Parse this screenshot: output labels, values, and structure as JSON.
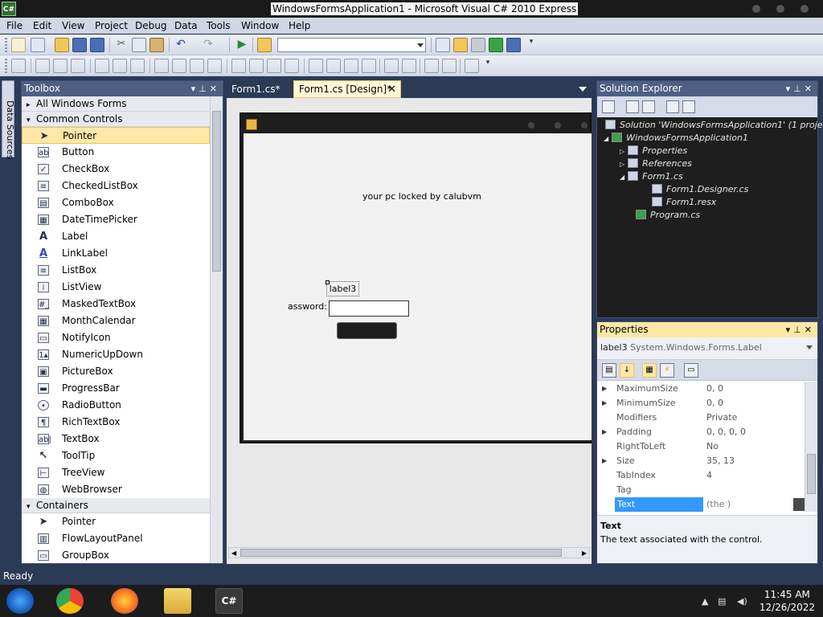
{
  "window": {
    "title": "WindowsFormsApplication1 - Microsoft Visual C# 2010 Express",
    "icon": "csharp-icon"
  },
  "menu": [
    "File",
    "Edit",
    "View",
    "Project",
    "Debug",
    "Data",
    "Tools",
    "Window",
    "Help"
  ],
  "toolbar": {
    "combo_value": ""
  },
  "data_sources_label": "Data Sources",
  "toolbox": {
    "title": "Toolbox",
    "categories": [
      {
        "label": "All Windows Forms",
        "expanded": false
      },
      {
        "label": "Common Controls",
        "expanded": true
      },
      {
        "label": "Containers",
        "expanded": true
      }
    ],
    "common_items": [
      "Pointer",
      "Button",
      "CheckBox",
      "CheckedListBox",
      "ComboBox",
      "DateTimePicker",
      "Label",
      "LinkLabel",
      "ListBox",
      "ListView",
      "MaskedTextBox",
      "MonthCalendar",
      "NotifyIcon",
      "NumericUpDown",
      "PictureBox",
      "ProgressBar",
      "RadioButton",
      "RichTextBox",
      "TextBox",
      "ToolTip",
      "TreeView",
      "WebBrowser"
    ],
    "container_items": [
      "Pointer",
      "FlowLayoutPanel",
      "GroupBox"
    ],
    "selected": "Pointer"
  },
  "tabs": [
    {
      "label": "Form1.cs*",
      "active": false
    },
    {
      "label": "Form1.cs [Design]*",
      "active": true
    }
  ],
  "form": {
    "lock_message": "your pc locked by calubvm",
    "label3_text": "label3",
    "password_label": "assword:",
    "password_value": ""
  },
  "solution_explorer": {
    "title": "Solution Explorer",
    "nodes": [
      "Solution 'WindowsFormsApplication1' (1 project)",
      "WindowsFormsApplication1",
      "Properties",
      "References",
      "Form1.cs",
      "Form1.Designer.cs",
      "Form1.resx",
      "Program.cs"
    ]
  },
  "properties": {
    "title": "Properties",
    "object_name": "label3",
    "object_type": "System.Windows.Forms.Label",
    "rows": [
      {
        "name": "MaximumSize",
        "value": "0, 0",
        "expandable": true
      },
      {
        "name": "MinimumSize",
        "value": "0, 0",
        "expandable": true
      },
      {
        "name": "Modifiers",
        "value": "Private",
        "expandable": false
      },
      {
        "name": "Padding",
        "value": "0, 0, 0, 0",
        "expandable": true
      },
      {
        "name": "RightToLeft",
        "value": "No",
        "expandable": false
      },
      {
        "name": "Size",
        "value": "35, 13",
        "expandable": true
      },
      {
        "name": "TabIndex",
        "value": "4",
        "expandable": false
      },
      {
        "name": "Tag",
        "value": "",
        "expandable": false
      },
      {
        "name": "Text",
        "value": "(the )",
        "expandable": false,
        "selected": true
      }
    ],
    "desc_title": "Text",
    "desc_text": "The text associated with the control."
  },
  "status": "Ready",
  "taskbar": {
    "apps": [
      "windows-start-icon",
      "chrome-icon",
      "firefox-icon",
      "file-explorer-icon",
      "visual-csharp-icon"
    ],
    "time": "11:45 AM",
    "date": "12/26/2022"
  },
  "colors": {
    "accent": "#4d6082",
    "selection": "#3399ff",
    "highlight": "#ffe8a6"
  }
}
